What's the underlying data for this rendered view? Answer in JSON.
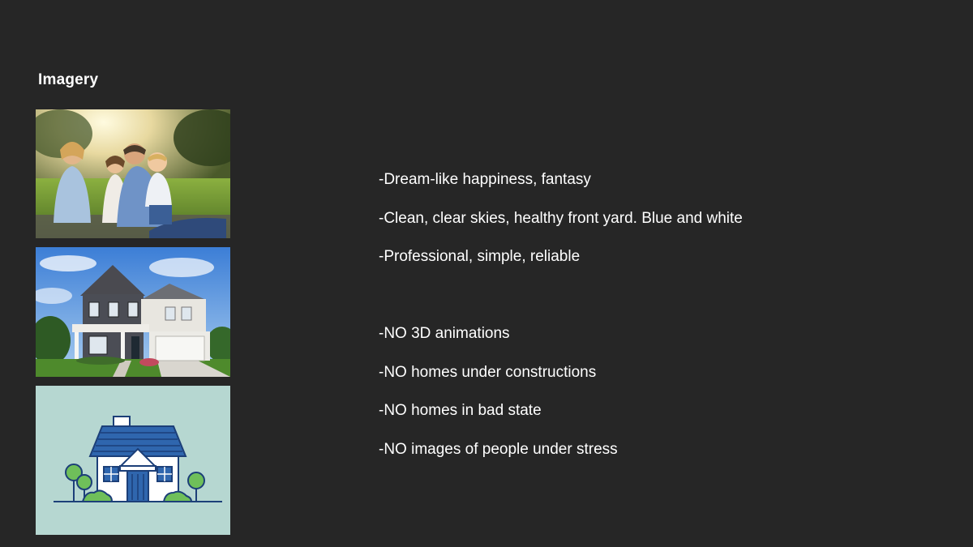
{
  "slide": {
    "title": "Imagery"
  },
  "images": [
    {
      "name": "family-photo",
      "kind": "photo"
    },
    {
      "name": "house-photo",
      "kind": "photo"
    },
    {
      "name": "house-illustration",
      "kind": "illustration",
      "colors": {
        "background": "#b6d7d1",
        "roof": "#2f66ae",
        "walls": "#ffffff",
        "door": "#2f66ae",
        "trees": "#6fbf5a",
        "outline": "#1c3f78"
      }
    }
  ],
  "dos": [
    "-Dream-like happiness, fantasy",
    "-Clean, clear skies, healthy front yard. Blue and white",
    "-Professional, simple, reliable"
  ],
  "donts": [
    "-NO 3D animations",
    "-NO homes under constructions",
    "-NO homes in bad state",
    "-NO images of people under stress"
  ]
}
